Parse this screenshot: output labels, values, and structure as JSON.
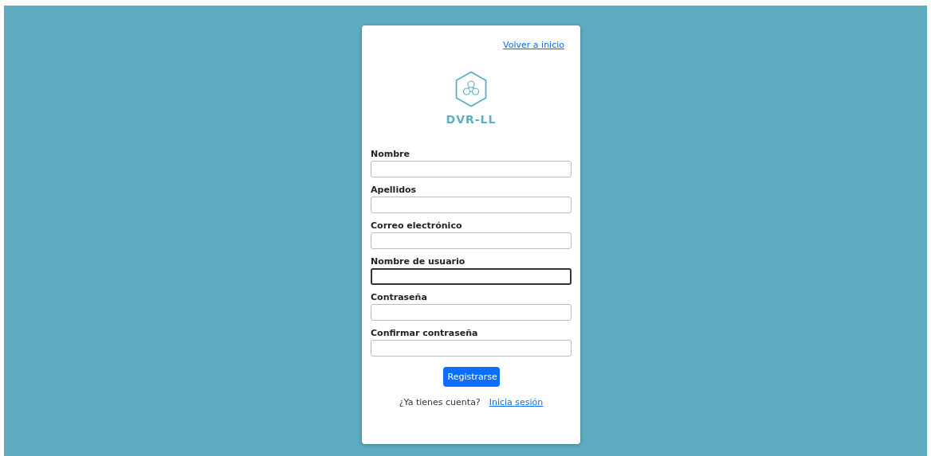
{
  "back_link": "Volver a inicio",
  "brand": "DVR-LL",
  "fields": [
    {
      "label": "Nombre",
      "focused": false
    },
    {
      "label": "Apellidos",
      "focused": false
    },
    {
      "label": "Correo electrónico",
      "focused": false
    },
    {
      "label": "Nombre de usuario",
      "focused": true
    },
    {
      "label": "Contraseña",
      "focused": false
    },
    {
      "label": "Confirmar contraseña",
      "focused": false
    }
  ],
  "submit_button": "Registrarse",
  "footer": {
    "text": "¿Ya tienes cuenta?",
    "link": "Inicia sesión"
  }
}
